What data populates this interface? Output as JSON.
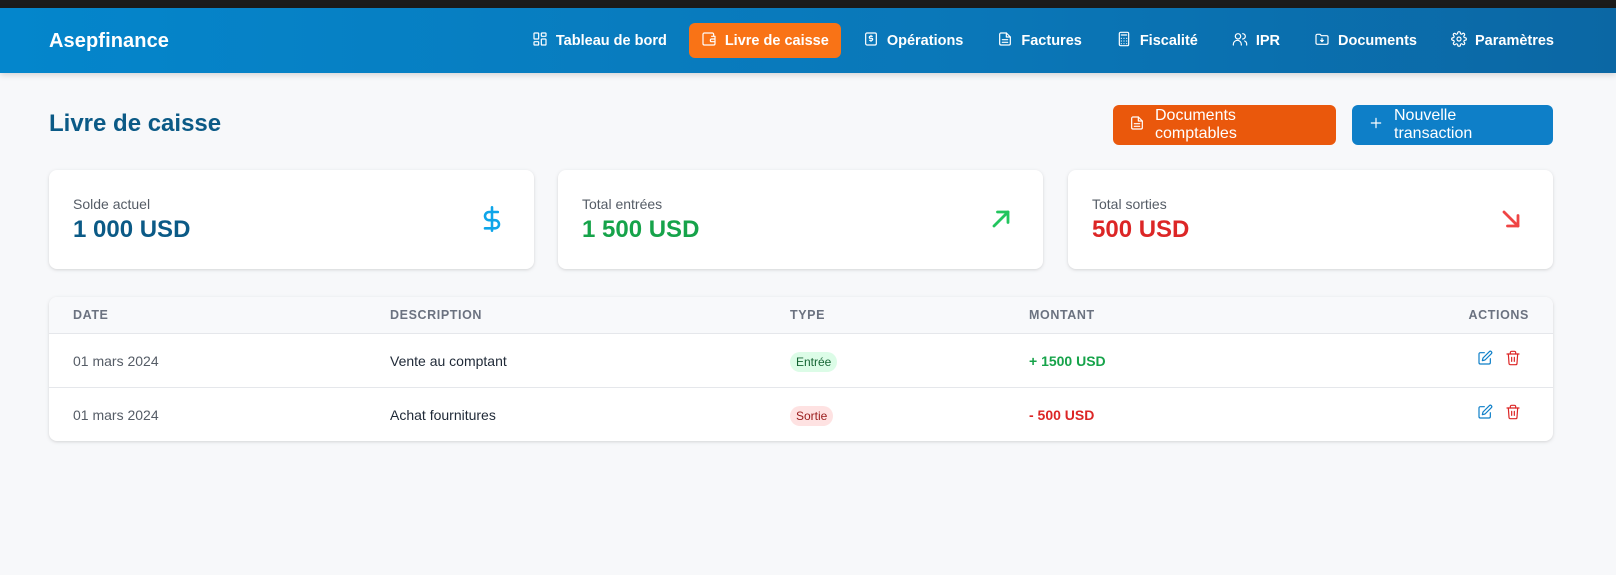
{
  "app": {
    "brand": "Asepfinance"
  },
  "nav": {
    "items": [
      {
        "label": "Tableau de bord",
        "icon": "dashboard-icon"
      },
      {
        "label": "Livre de caisse",
        "icon": "wallet-icon",
        "active": true
      },
      {
        "label": "Opérations",
        "icon": "dollar-receipt-icon"
      },
      {
        "label": "Factures",
        "icon": "file-text-icon"
      },
      {
        "label": "Fiscalité",
        "icon": "calculator-icon"
      },
      {
        "label": "IPR",
        "icon": "users-icon"
      },
      {
        "label": "Documents",
        "icon": "folder-icon"
      },
      {
        "label": "Paramètres",
        "icon": "gear-icon"
      }
    ]
  },
  "page": {
    "title": "Livre de caisse",
    "buttons": {
      "documents": "Documents comptables",
      "new_transaction": "Nouvelle transaction"
    }
  },
  "cards": {
    "balance": {
      "label": "Solde actuel",
      "value": "1 000 USD",
      "icon": "dollar-icon"
    },
    "income": {
      "label": "Total entrées",
      "value": "1 500 USD",
      "icon": "arrow-up-right-icon"
    },
    "expense": {
      "label": "Total sorties",
      "value": "500 USD",
      "icon": "arrow-down-right-icon"
    }
  },
  "table": {
    "headers": {
      "date": "DATE",
      "description": "DESCRIPTION",
      "type": "TYPE",
      "amount": "MONTANT",
      "actions": "ACTIONS"
    },
    "rows": [
      {
        "date": "01 mars 2024",
        "description": "Vente au comptant",
        "type": "Entrée",
        "amount": "+ 1500 USD"
      },
      {
        "date": "01 mars 2024",
        "description": "Achat fournitures",
        "type": "Sortie",
        "amount": "- 500 USD"
      }
    ]
  },
  "colors": {
    "nav_bg": "#0a77b8",
    "accent_orange": "#f97316",
    "primary_blue": "#0e7fc8",
    "income_green": "#16a34a",
    "expense_red": "#dc2626"
  }
}
